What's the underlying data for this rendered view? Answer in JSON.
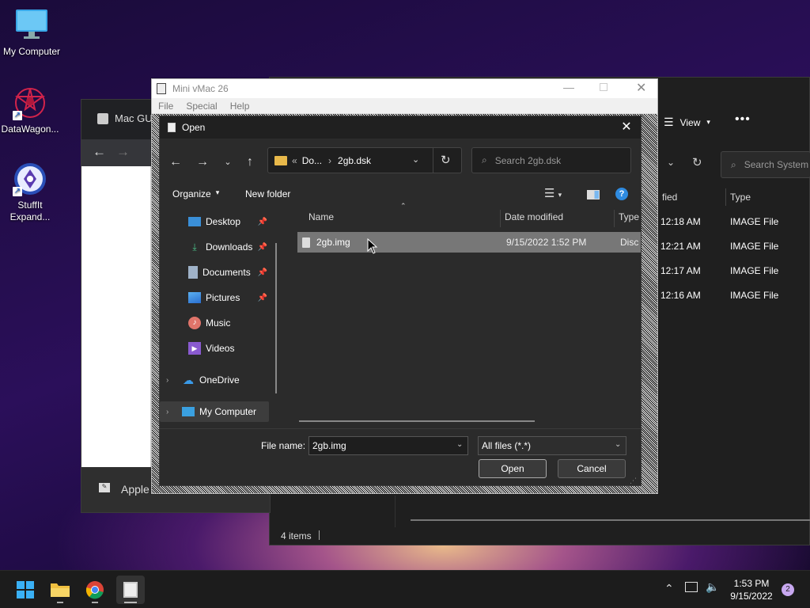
{
  "desktop": {
    "icons": [
      {
        "label": "My Computer"
      },
      {
        "label": "DataWagon..."
      },
      {
        "label": "StuffIt Expand..."
      }
    ]
  },
  "bg_browser": {
    "tab_title": "Mac GU",
    "bottom_text": "Apple"
  },
  "bg_explorer": {
    "view_label": "View",
    "search_placeholder": "Search System",
    "col_modified": "fied",
    "col_type": "Type",
    "rows": [
      {
        "time": "12:18 AM",
        "type": "IMAGE File"
      },
      {
        "time": "12:21 AM",
        "type": "IMAGE File"
      },
      {
        "time": "12:17 AM",
        "type": "IMAGE File"
      },
      {
        "time": "12:16 AM",
        "type": "IMAGE File"
      }
    ],
    "status": "4 items"
  },
  "vmac": {
    "title": "Mini vMac 26",
    "menu": [
      "File",
      "Special",
      "Help"
    ]
  },
  "dialog": {
    "title": "Open",
    "address": {
      "prefix": "«",
      "part1": "Do...",
      "sep": "›",
      "part2": "2gb.dsk"
    },
    "search_placeholder": "Search 2gb.dsk",
    "organize": "Organize",
    "new_folder": "New folder",
    "sidebar": [
      {
        "label": "Desktop"
      },
      {
        "label": "Downloads"
      },
      {
        "label": "Documents"
      },
      {
        "label": "Pictures"
      },
      {
        "label": "Music"
      },
      {
        "label": "Videos"
      },
      {
        "label": "OneDrive"
      },
      {
        "label": "My Computer"
      }
    ],
    "columns": {
      "name": "Name",
      "date": "Date modified",
      "type": "Type"
    },
    "file": {
      "name": "2gb.img",
      "date": "9/15/2022 1:52 PM",
      "type": "Disc"
    },
    "filename_label": "File name:",
    "filename_value": "2gb.img",
    "filter_value": "All files (*.*)",
    "open_label": "Open",
    "cancel_label": "Cancel"
  },
  "taskbar": {
    "time": "1:53 PM",
    "date": "9/15/2022",
    "notifications": "2"
  },
  "colors": {
    "accent": "#0078d4",
    "selection": "#777777"
  }
}
